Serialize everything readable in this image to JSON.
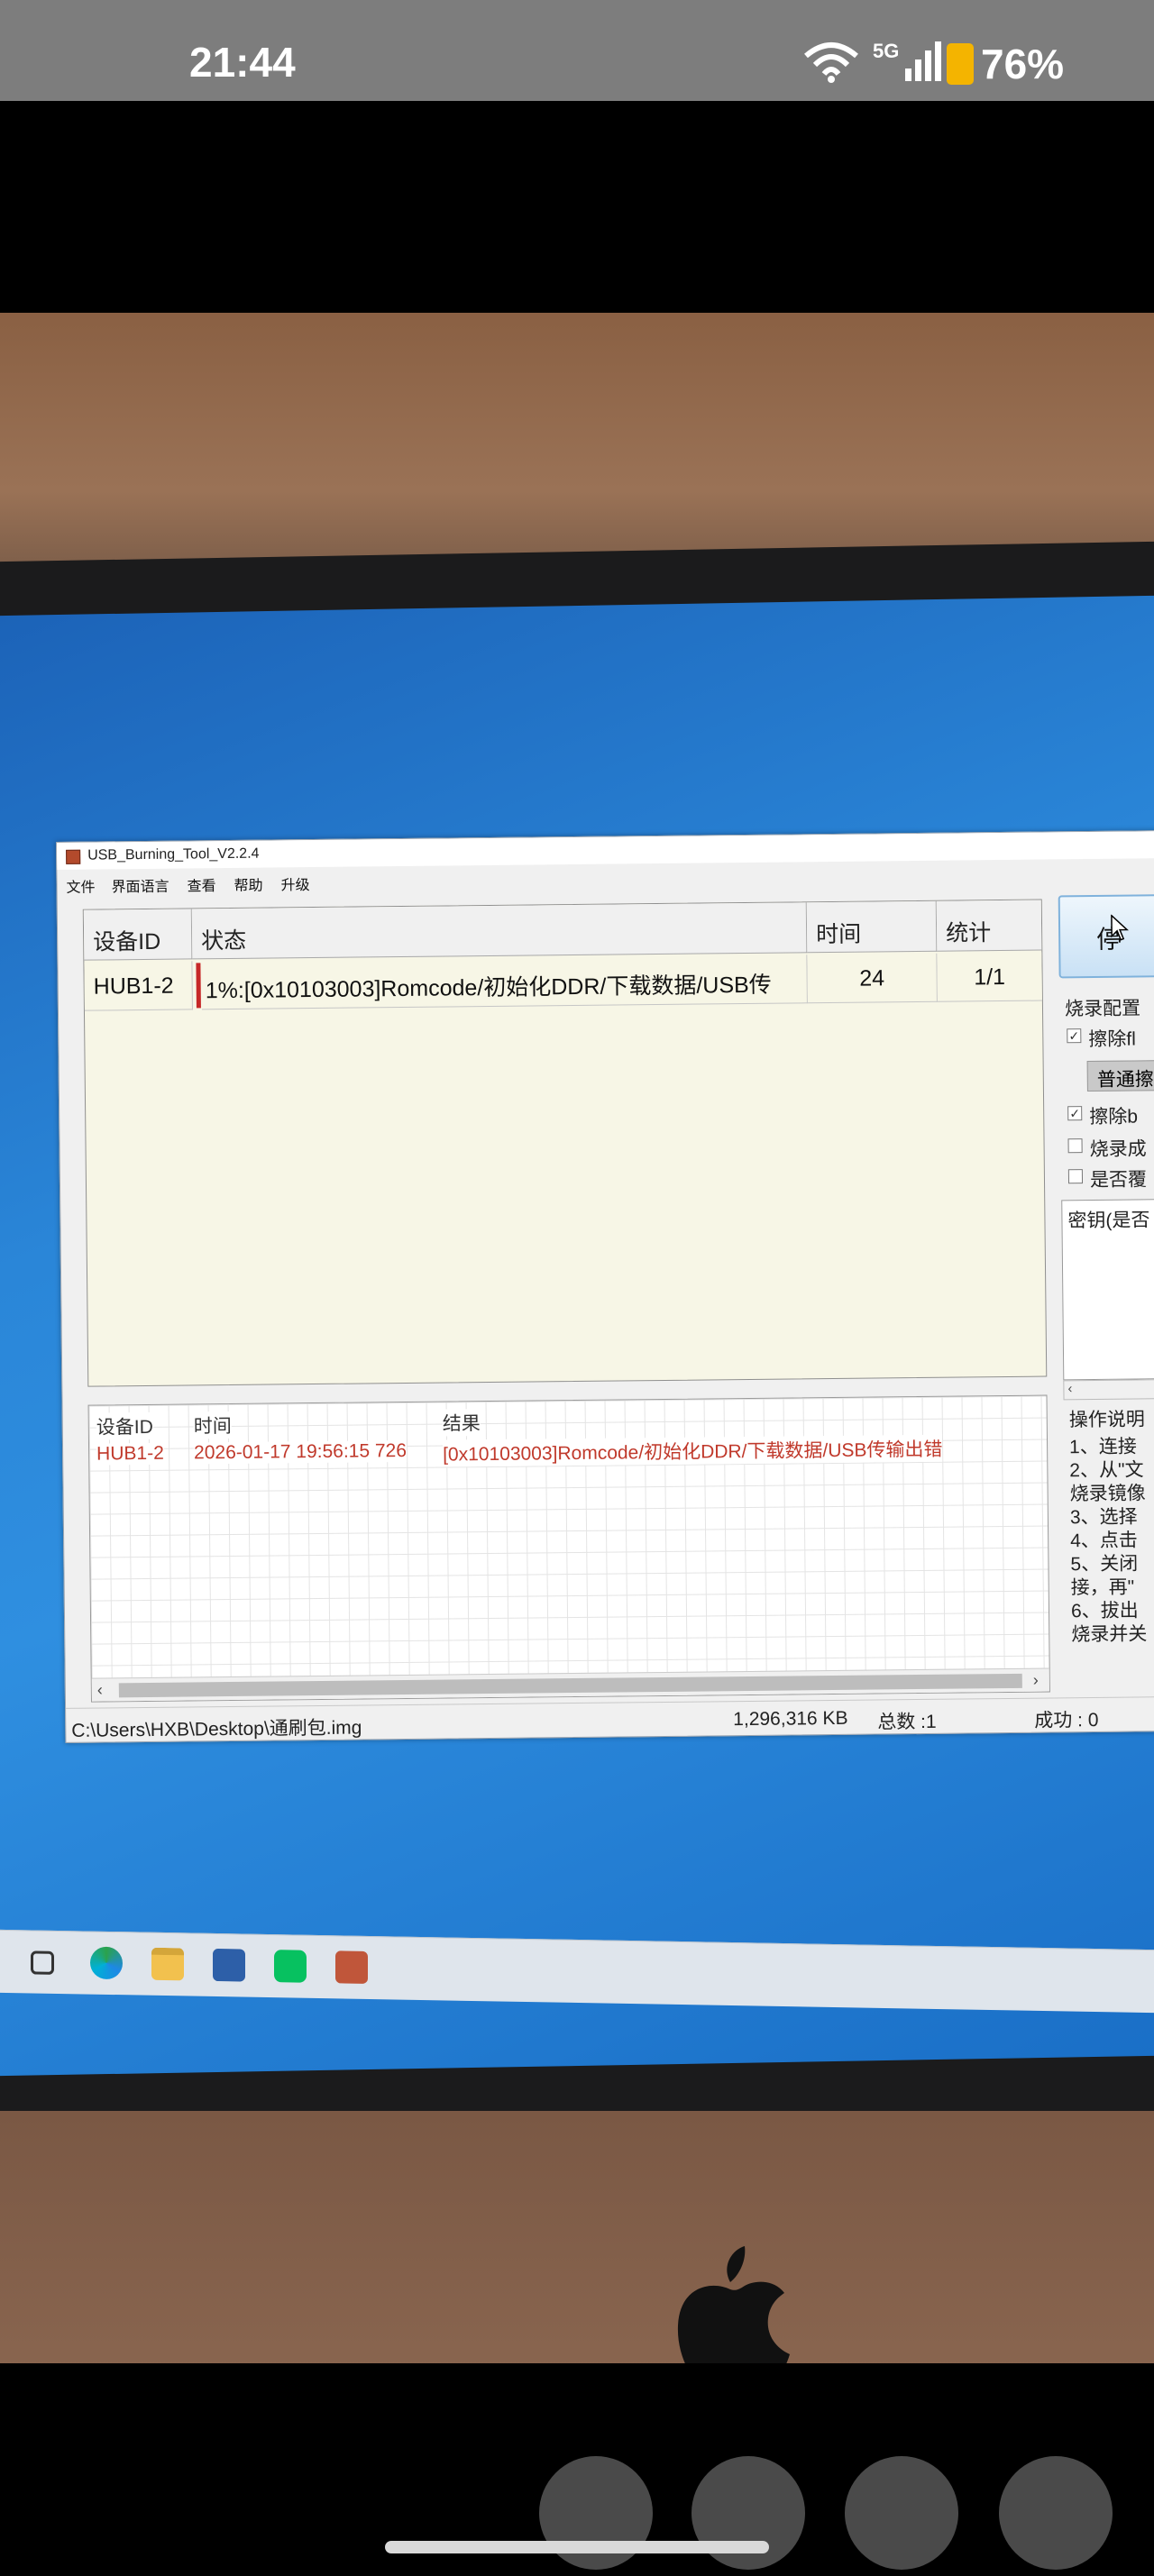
{
  "status_bar": {
    "time": "21:44",
    "network": "5G",
    "battery": "76%",
    "icons": [
      "wifi-icon",
      "signal-icon",
      "battery-icon"
    ]
  },
  "app": {
    "title": "USB_Burning_Tool_V2.2.4",
    "menu": [
      "文件",
      "界面语言",
      "查看",
      "帮助",
      "升级"
    ],
    "device_table": {
      "headers": [
        "设备ID",
        "状态",
        "时间",
        "统计"
      ],
      "rows": [
        {
          "device_id": "HUB1-2",
          "status": "1%:[0x10103003]Romcode/初始化DDR/下载数据/USB传",
          "time": "24",
          "stats": "1/1"
        }
      ]
    },
    "log": {
      "headers": [
        "设备ID",
        "时间",
        "结果"
      ],
      "rows": [
        {
          "device_id": "HUB1-2",
          "time": "2026-01-17 19:56:15 726",
          "result": "[0x10103003]Romcode/初始化DDR/下载数据/USB传输出错"
        }
      ]
    },
    "status": {
      "path": "C:\\Users\\HXB\\Desktop\\通刷包.img",
      "size": "1,296,316 KB",
      "total": "总数 :1",
      "success": "成功 : 0"
    },
    "right_panel": {
      "stop_button": "停",
      "config_label": "烧录配置",
      "erase_flash": "擦除fl",
      "erase_mode": "普通擦",
      "erase_bootloader": "擦除b",
      "burn_success": "烧录成",
      "whether_overwrite": "是否覆",
      "key_label": "密钥(是否",
      "instructions_title": "操作说明",
      "instructions": [
        "1、连接",
        "2、从\"文",
        "烧录镜像",
        "3、选择",
        "4、点击",
        "5、关闭",
        "接，再\"",
        "6、拔出",
        "烧录并关"
      ]
    }
  },
  "colors": {
    "desktop": "#2a86d8",
    "table_bg": "#f7f6e6",
    "log_error": "#c0392b",
    "progress_mark": "#c62828"
  }
}
